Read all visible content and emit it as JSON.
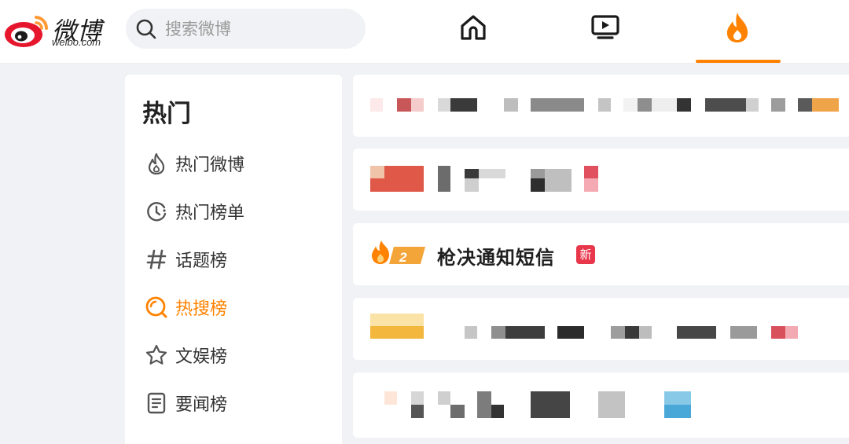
{
  "brand": {
    "name_cn": "微博",
    "name_en": "weibo.com"
  },
  "search": {
    "placeholder": "搜索微博"
  },
  "topnav": {
    "items": [
      {
        "name": "home",
        "icon": "home-icon"
      },
      {
        "name": "video",
        "icon": "video-icon"
      },
      {
        "name": "hot",
        "icon": "flame-icon",
        "active": true
      }
    ],
    "accent": "#ff8200"
  },
  "sidebar": {
    "title": "热门",
    "items": [
      {
        "label": "热门微博",
        "icon": "flame-outline-icon"
      },
      {
        "label": "热门榜单",
        "icon": "clock-icon"
      },
      {
        "label": "话题榜",
        "icon": "hashtag-icon"
      },
      {
        "label": "热搜榜",
        "icon": "search-ring-icon",
        "active": true
      },
      {
        "label": "文娱榜",
        "icon": "star-icon"
      },
      {
        "label": "要闻榜",
        "icon": "news-icon"
      }
    ]
  },
  "feed": {
    "highlight": {
      "rank": "2",
      "title": "枪决通知短信",
      "badge": "新"
    }
  }
}
